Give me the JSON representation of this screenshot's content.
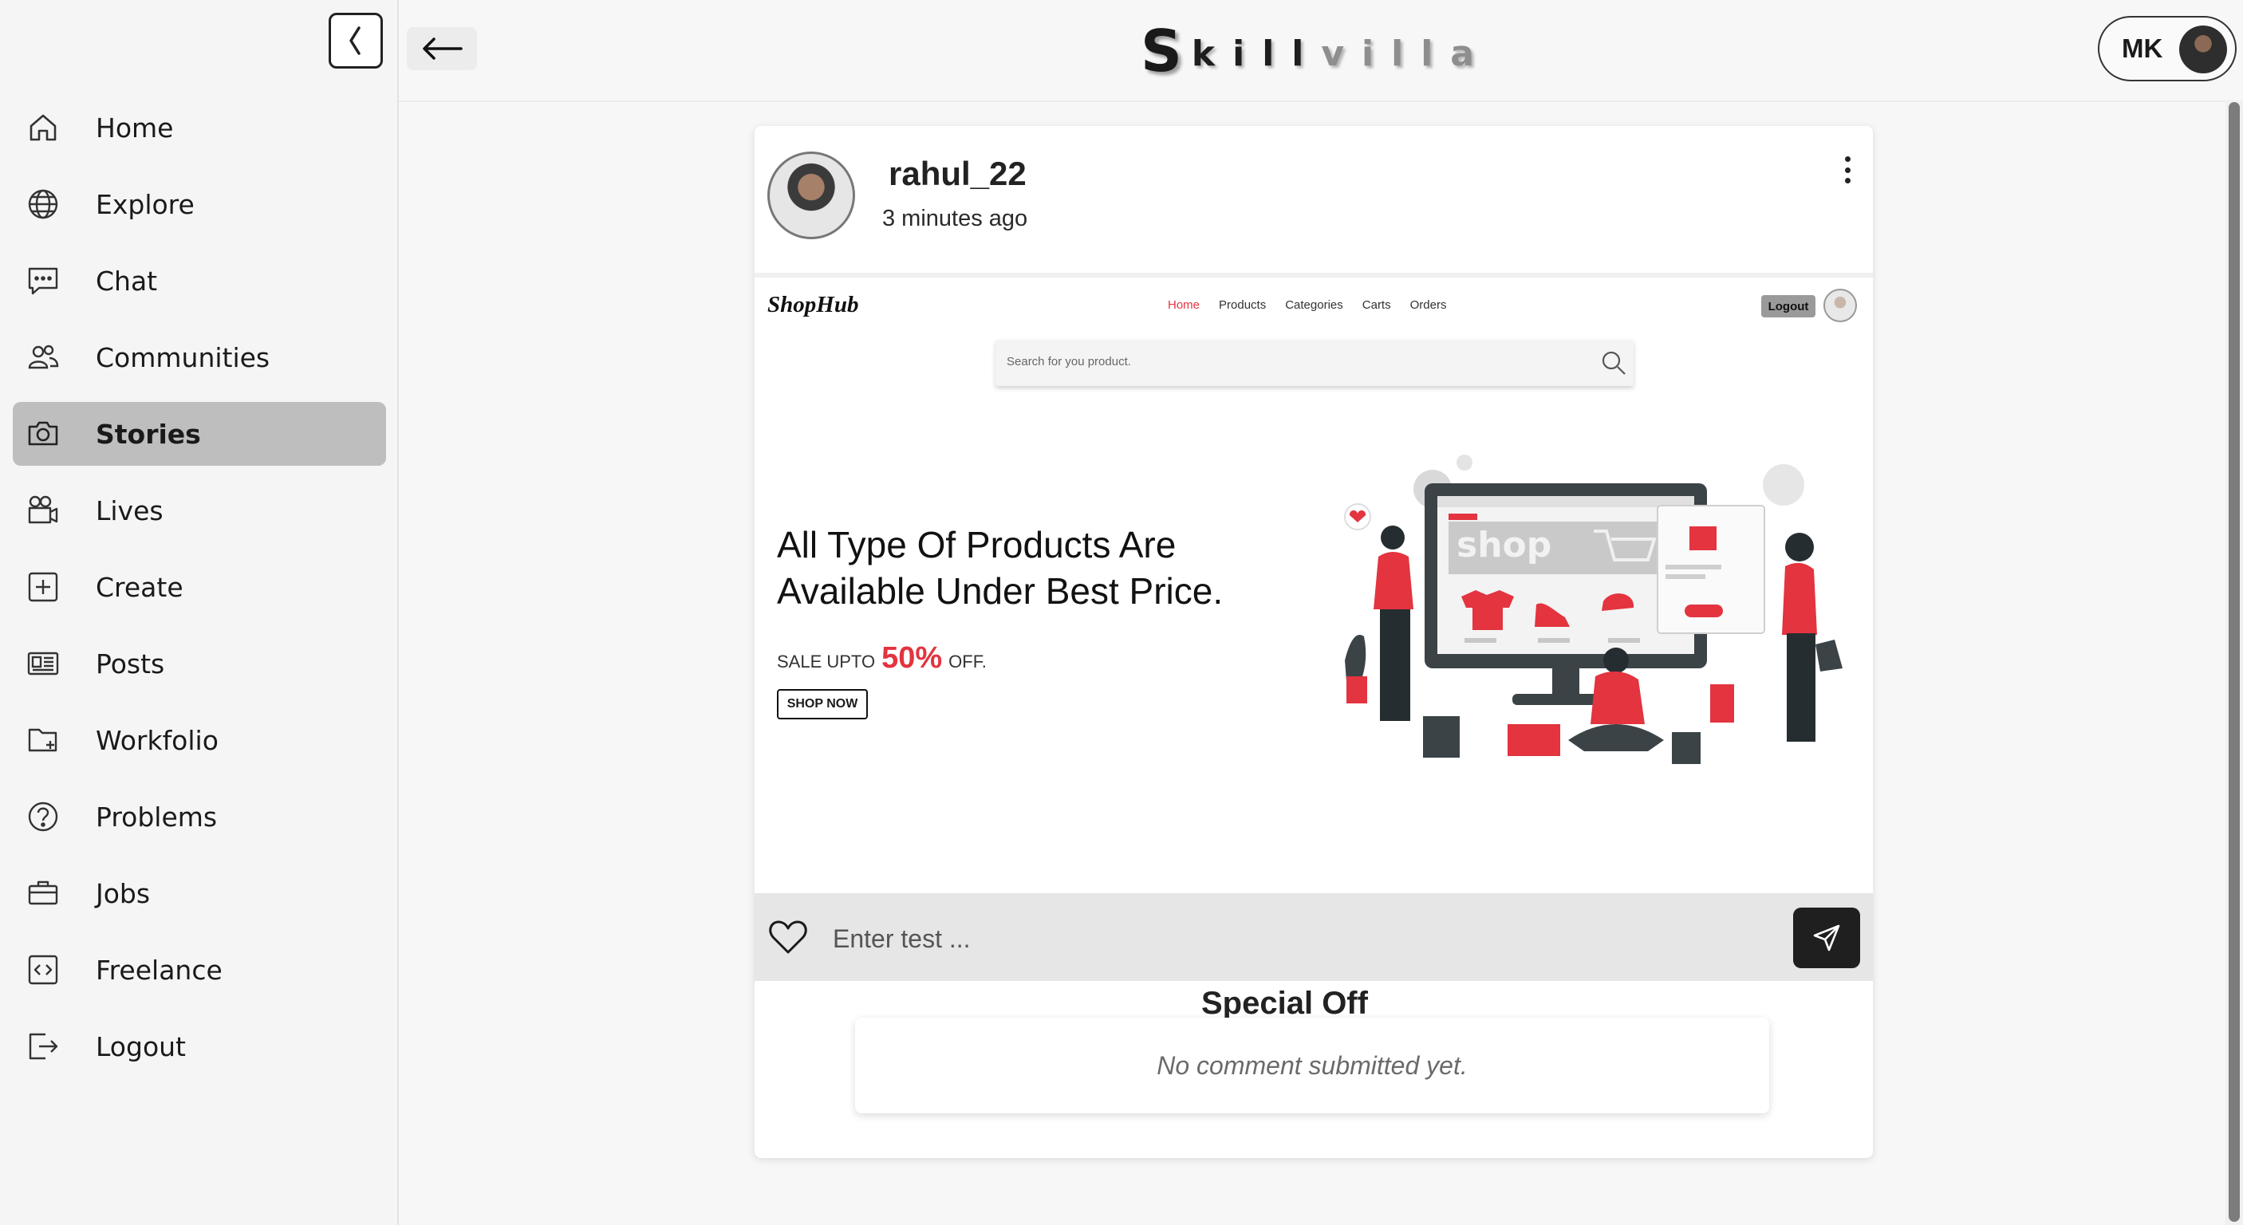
{
  "app": {
    "logo_first": "S",
    "logo_dark": "kill",
    "logo_light": "villa"
  },
  "sidebar": {
    "active": "Stories",
    "items": [
      {
        "label": "Home",
        "icon": "home-icon"
      },
      {
        "label": "Explore",
        "icon": "globe-icon"
      },
      {
        "label": "Chat",
        "icon": "chat-icon"
      },
      {
        "label": "Communities",
        "icon": "users-icon"
      },
      {
        "label": "Stories",
        "icon": "camera-icon"
      },
      {
        "label": "Lives",
        "icon": "video-icon"
      },
      {
        "label": "Create",
        "icon": "plus-square-icon"
      },
      {
        "label": "Posts",
        "icon": "newspaper-icon"
      },
      {
        "label": "Workfolio",
        "icon": "folder-plus-icon"
      },
      {
        "label": "Problems",
        "icon": "question-icon"
      },
      {
        "label": "Jobs",
        "icon": "briefcase-icon"
      },
      {
        "label": "Freelance",
        "icon": "code-icon"
      },
      {
        "label": "Logout",
        "icon": "logout-icon"
      }
    ]
  },
  "header": {
    "user_initials": "MK"
  },
  "post": {
    "username": "rahul_22",
    "time": "3 minutes ago",
    "image": {
      "brand": "ShopHub",
      "nav": [
        "Home",
        "Products",
        "Categories",
        "Carts",
        "Orders"
      ],
      "logout": "Logout",
      "search_placeholder": "Search for you product.",
      "hero_title": "All Type Of Products Are Available Under Best Price.",
      "sale_prefix": "SALE UPTO",
      "sale_percent": "50%",
      "sale_suffix": "OFF.",
      "shop_now": "SHOP NOW",
      "illustration_word": "shop",
      "partial_heading": "Special Off"
    },
    "comment_placeholder": "Enter test ...",
    "no_comments": "No comment submitted yet."
  },
  "colors": {
    "accent": "#e3343f",
    "active_nav": "#bfbebe",
    "send_button": "#1f1f1f"
  }
}
